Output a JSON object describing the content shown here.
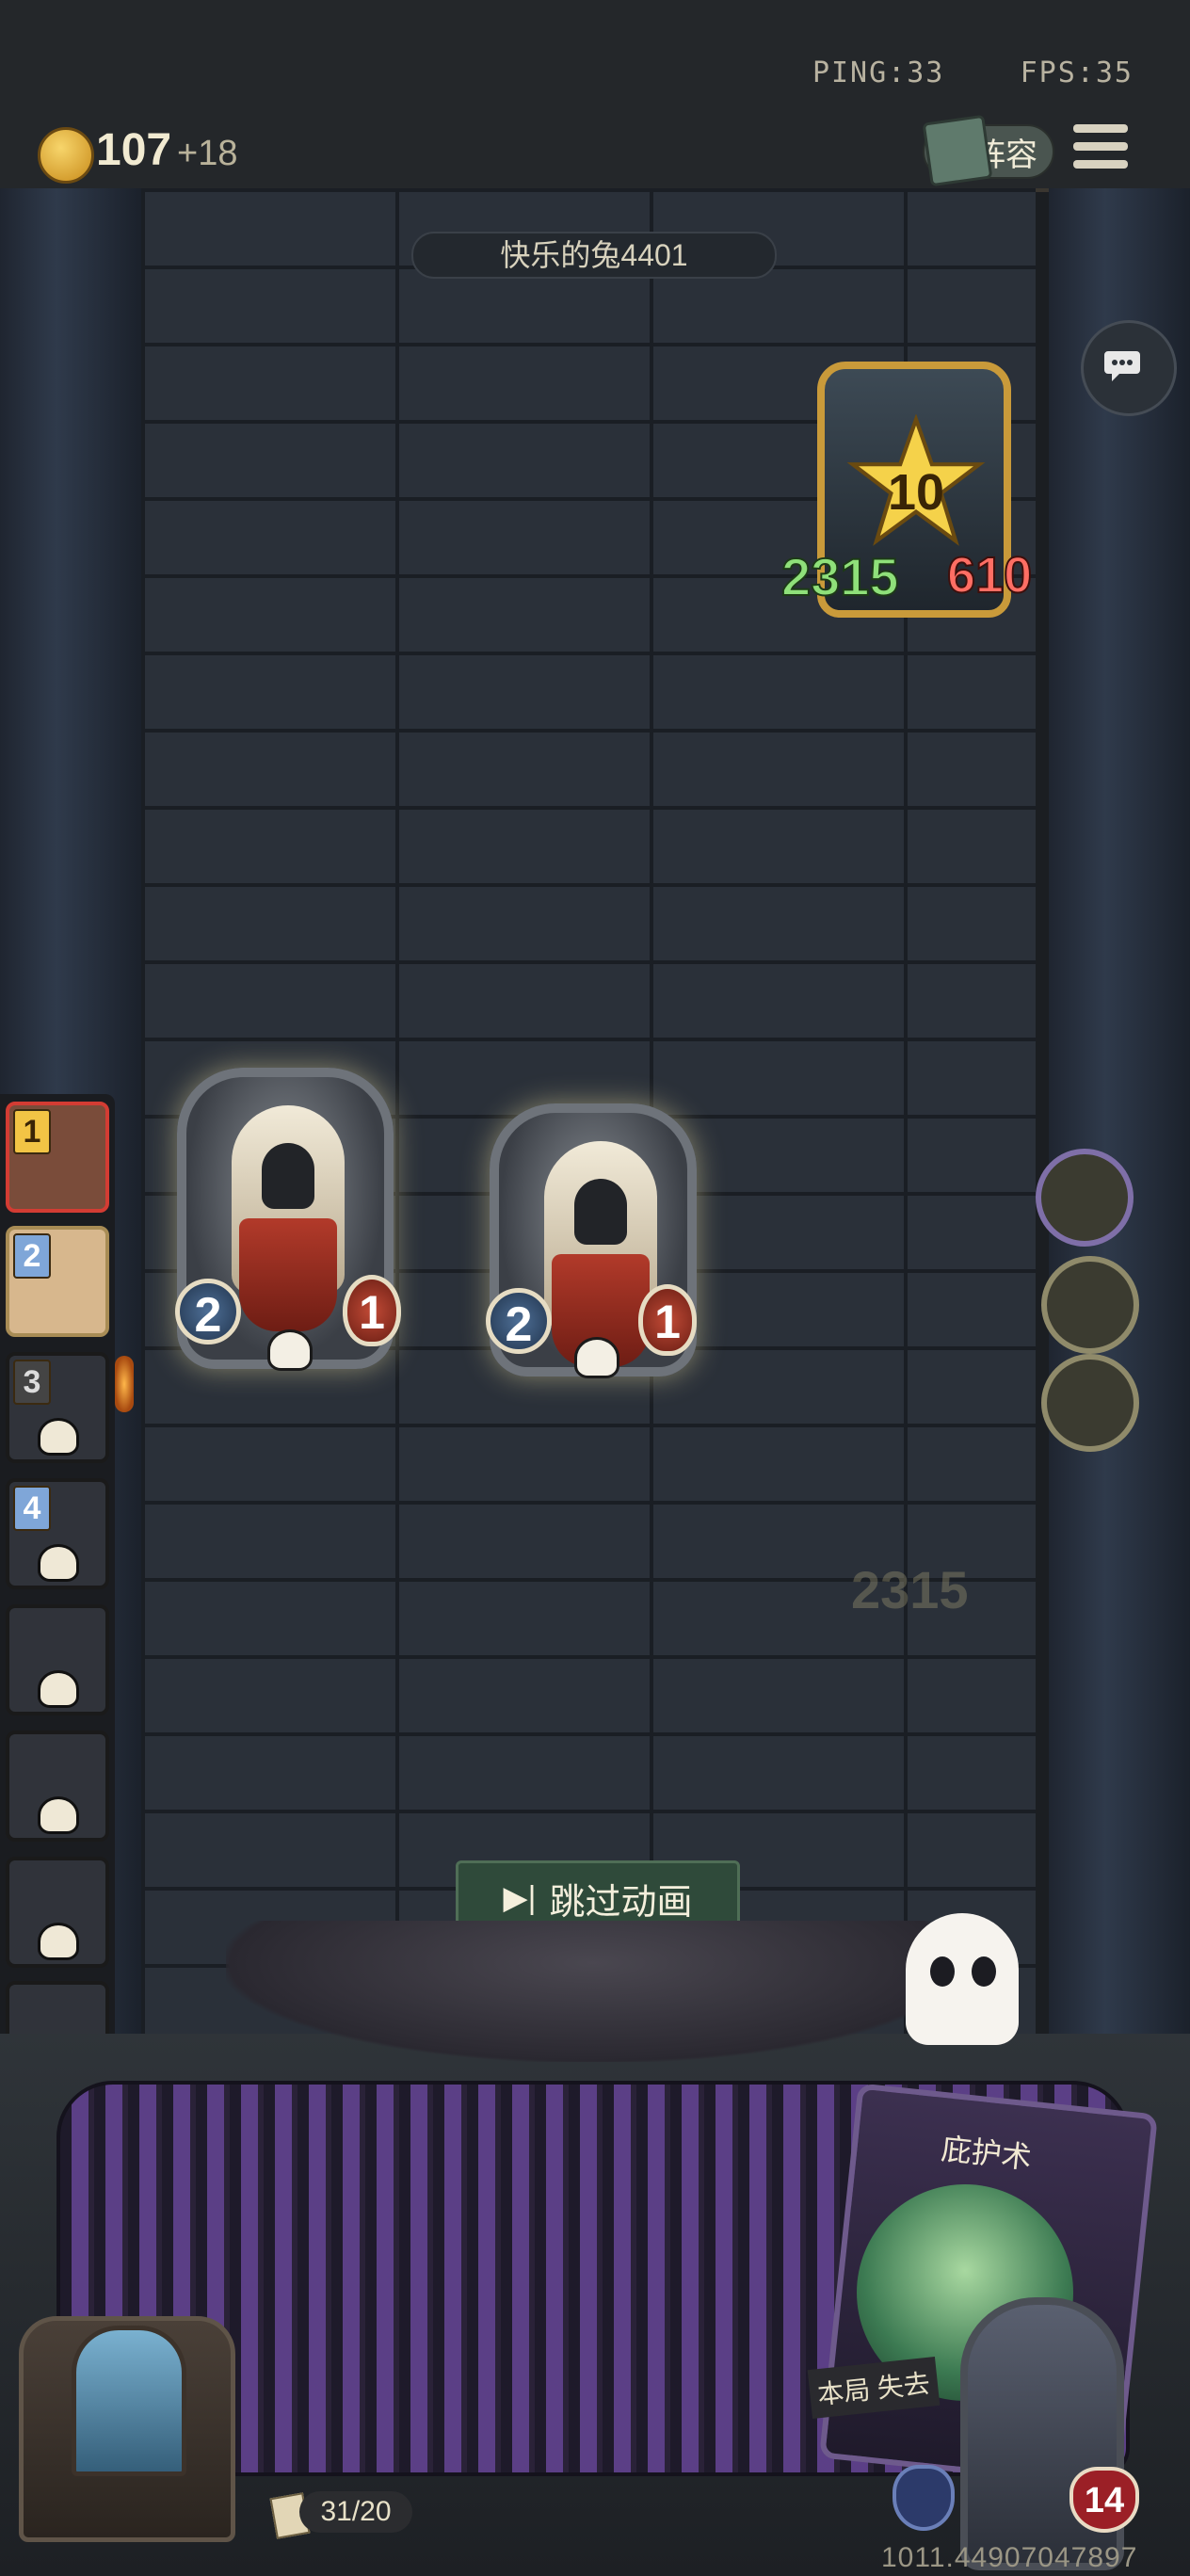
{
  "top_bar": {
    "ping": "PING:33",
    "fps": "FPS:35",
    "gold": "107",
    "gold_bonus": "+18",
    "lineup_label": "阵容"
  },
  "opponent": {
    "name": "快乐的兔4401",
    "level": "10",
    "attack": "2315",
    "health": "610"
  },
  "board": {
    "minions": [
      {
        "attack": "2",
        "health": "1"
      },
      {
        "attack": "2",
        "health": "1"
      }
    ],
    "ghost_number": "2315"
  },
  "order_list": [
    {
      "num": "1"
    },
    {
      "num": "2"
    },
    {
      "num": "3"
    },
    {
      "num": "4"
    }
  ],
  "skip_button": {
    "label": "跳过动画"
  },
  "hand": {
    "spell_name": "庇护术",
    "spell_desc": "本局 失去"
  },
  "player": {
    "health": "14",
    "deck_count": "31/20",
    "build_id": "1011.44907047897"
  },
  "colors": {
    "gold": "#f2c445",
    "attack_green": "#8fe07a",
    "health_red": "#ff6e64",
    "skip_bg": "#2f4a3a"
  }
}
